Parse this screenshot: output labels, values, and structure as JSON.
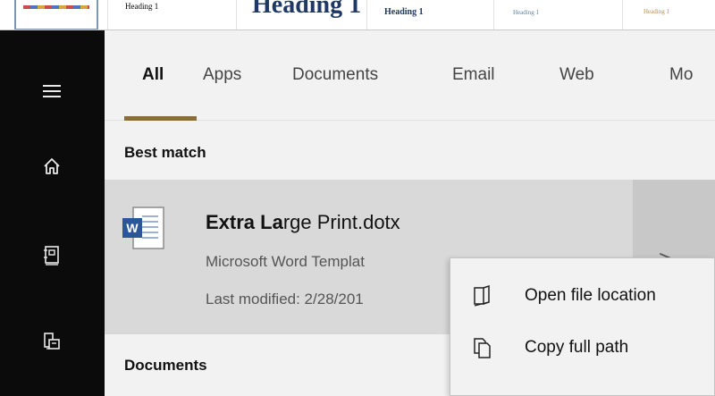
{
  "doc_strip": {
    "heading_small": "Heading 1",
    "heading_large": "Heading 1",
    "heading_bold": "Heading 1",
    "heading_light": "Heading 1",
    "heading_tiny": "Heading 1"
  },
  "sidebar": {
    "items": [
      {
        "icon": "hamburger-menu-icon"
      },
      {
        "icon": "home-icon"
      },
      {
        "icon": "notebook-icon"
      },
      {
        "icon": "devices-icon"
      }
    ]
  },
  "tabs": [
    {
      "label": "All",
      "active": true
    },
    {
      "label": "Apps",
      "active": false
    },
    {
      "label": "Documents",
      "active": false
    },
    {
      "label": "Email",
      "active": false
    },
    {
      "label": "Web",
      "active": false
    },
    {
      "label": "Mo",
      "active": false
    }
  ],
  "best_match": {
    "section_label": "Best match",
    "title_bold": "Extra La",
    "title_rest": "rge Print.dotx",
    "type": "Microsoft Word Templat",
    "modified": "Last modified: 2/28/201",
    "icon": "word-document-icon",
    "arrow": ">"
  },
  "documents": {
    "section_label": "Documents"
  },
  "context_menu": {
    "items": [
      {
        "label": "Open file location",
        "icon": "open-folder-icon"
      },
      {
        "label": "Copy full path",
        "icon": "copy-icon"
      }
    ]
  },
  "colors": {
    "rail": "#0b0b0b",
    "accent_underline": "#8a6d3b",
    "word_blue": "#2b579a"
  }
}
